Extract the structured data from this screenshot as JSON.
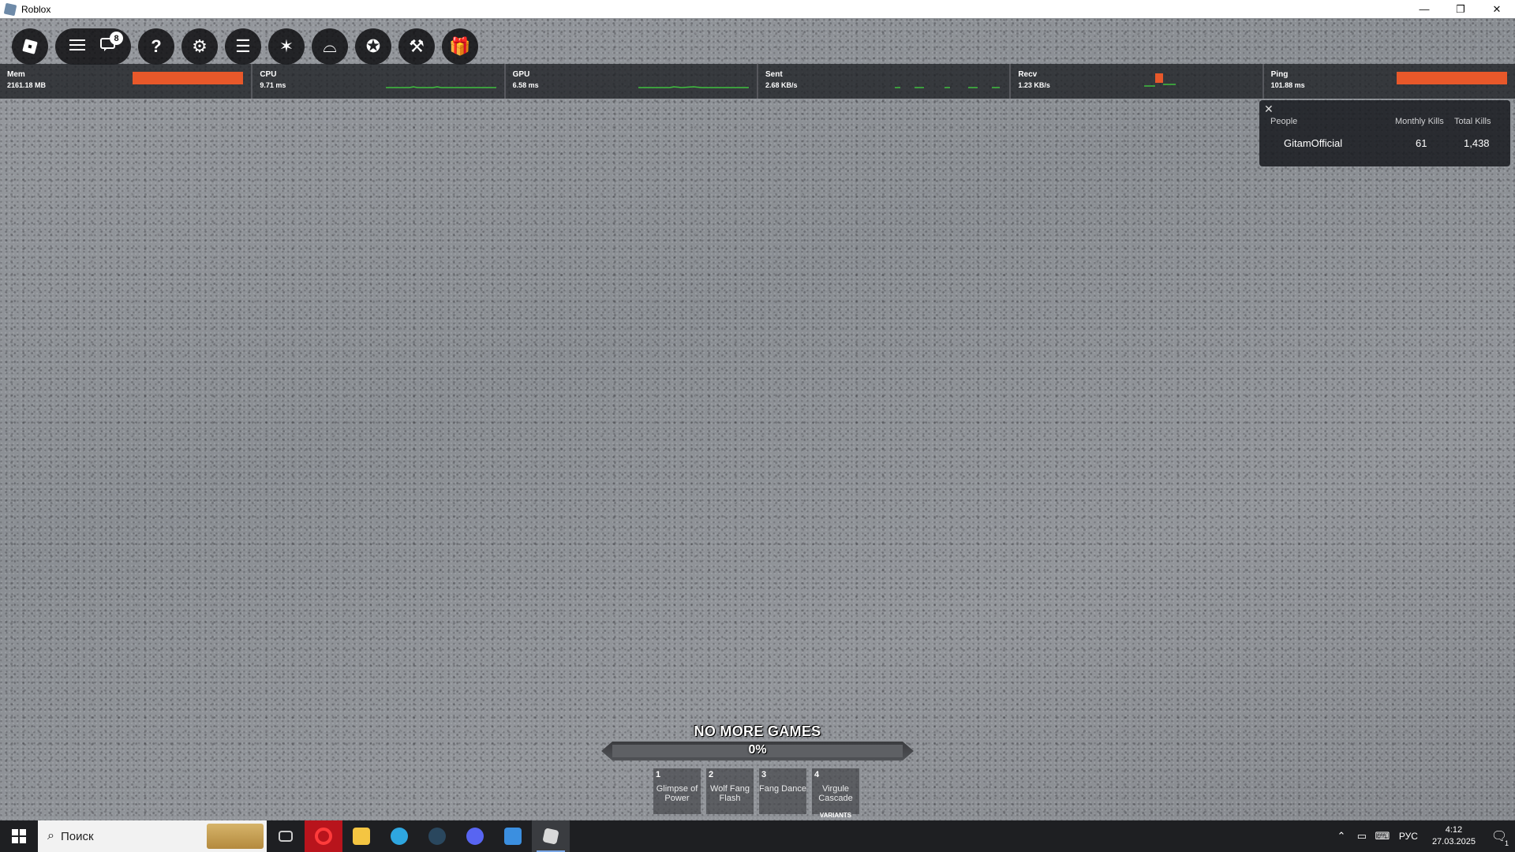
{
  "window": {
    "title": "Roblox",
    "controls": {
      "minimize": "—",
      "restore": "❐",
      "close": "✕"
    }
  },
  "toolbar": {
    "roblox_menu_icon": "roblox-logo-icon",
    "menu_icon": "hamburger-icon",
    "chat_icon": "chat-icon",
    "chat_badge": "8",
    "buttons": [
      {
        "icon": "help-icon",
        "glyph": "?"
      },
      {
        "icon": "gear-icon",
        "glyph": "⚙"
      },
      {
        "icon": "stats-list-icon",
        "glyph": "☰"
      },
      {
        "icon": "emote-icon",
        "glyph": "✶"
      },
      {
        "icon": "hat-icon",
        "glyph": "⌓"
      },
      {
        "icon": "badge-icon",
        "glyph": "✪"
      },
      {
        "icon": "hammer-icon",
        "glyph": "⚒"
      },
      {
        "icon": "gift-icon",
        "glyph": "🎁"
      }
    ]
  },
  "stats": [
    {
      "name": "Mem",
      "value": "2161.18 MB",
      "display": "bar"
    },
    {
      "name": "CPU",
      "value": "9.71 ms",
      "display": "graph"
    },
    {
      "name": "GPU",
      "value": "6.58 ms",
      "display": "graph"
    },
    {
      "name": "Sent",
      "value": "2.68 KB/s",
      "display": "graph"
    },
    {
      "name": "Recv",
      "value": "1.23 KB/s",
      "display": "graph"
    },
    {
      "name": "Ping",
      "value": "101.88 ms",
      "display": "bar"
    }
  ],
  "colors": {
    "stat_bar": "#e8582a",
    "graph_line": "#3fbf3f",
    "hud_text": "#ffffff"
  },
  "leaderboard": {
    "close": "✕",
    "headers": [
      "People",
      "Monthly Kills",
      "Total Kills"
    ],
    "rows": [
      {
        "name": "GitamOfficial",
        "monthly": "61",
        "total": "1,438"
      }
    ]
  },
  "hud": {
    "title": "NO MORE GAMES",
    "progress_text": "0%",
    "progress_fraction": 0
  },
  "hotbar": [
    {
      "key": "1",
      "label": "Glimpse of Power"
    },
    {
      "key": "2",
      "label": "Wolf Fang Flash"
    },
    {
      "key": "3",
      "label": "Fang Dance"
    },
    {
      "key": "4",
      "label": "Virgule Cascade",
      "extra": "VARIANTS"
    }
  ],
  "taskbar": {
    "search_placeholder": "Поиск",
    "apps": [
      {
        "name": "task-view",
        "color": "#cccccc"
      },
      {
        "name": "opera",
        "color": "#e0262f"
      },
      {
        "name": "file-explorer",
        "color": "#f4c542"
      },
      {
        "name": "telegram",
        "color": "#2ea6e0"
      },
      {
        "name": "steam",
        "color": "#2a475e"
      },
      {
        "name": "discord",
        "color": "#5865f2"
      },
      {
        "name": "microsoft-store",
        "color": "#3b8fe0"
      },
      {
        "name": "roblox",
        "color": "#d9d9d9"
      }
    ],
    "lang": "РУС",
    "time": "4:12",
    "date": "27.03.2025",
    "notif_count": "1"
  }
}
